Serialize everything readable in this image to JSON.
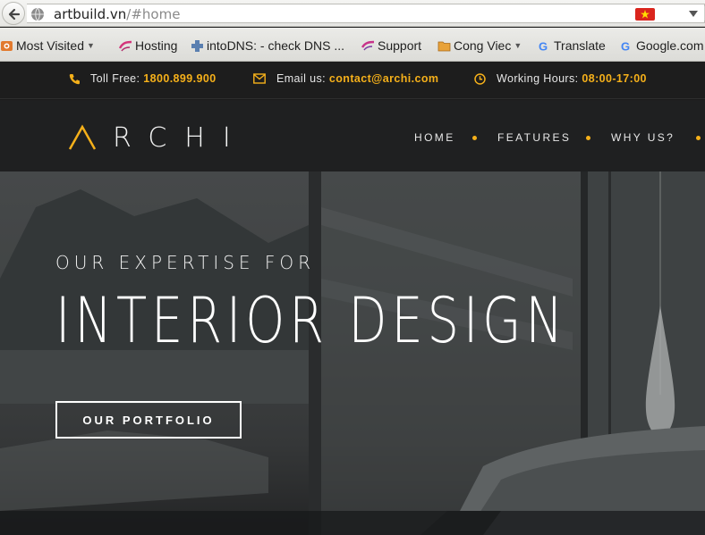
{
  "browser": {
    "url_host": "artbuild.vn",
    "url_path": "/#home",
    "bookmarks": [
      {
        "label": "Most Visited",
        "icon": "most-visited-icon",
        "has_dropdown": true
      },
      {
        "label": "Hosting",
        "icon": "hosting-icon",
        "has_dropdown": false
      },
      {
        "label": "intoDNS: - check DNS ...",
        "icon": "intodns-icon",
        "has_dropdown": false
      },
      {
        "label": "Support",
        "icon": "support-icon",
        "has_dropdown": false
      },
      {
        "label": "Cong Viec",
        "icon": "folder-icon",
        "has_dropdown": true
      },
      {
        "label": "Translate",
        "icon": "google-icon",
        "has_dropdown": false
      },
      {
        "label": "Google.com",
        "icon": "google-icon",
        "has_dropdown": false
      }
    ]
  },
  "topbar": {
    "phone_label": "Toll Free:",
    "phone_value": "1800.899.900",
    "email_label": "Email us:",
    "email_value": "contact@archi.com",
    "hours_label": "Working Hours:",
    "hours_value": "08:00-17:00"
  },
  "nav": {
    "logo_text": "RCHI",
    "items": [
      "HOME",
      "FEATURES",
      "WHY US?"
    ]
  },
  "hero": {
    "eyebrow": "OUR EXPERTISE FOR",
    "title": "INTERIOR DESIGN",
    "button_label": "OUR PORTFOLIO"
  },
  "colors": {
    "accent": "#f5b01a",
    "topbar_bg": "#1d1d1d",
    "nav_bg": "#1f2021",
    "text_light": "#ffffff"
  }
}
